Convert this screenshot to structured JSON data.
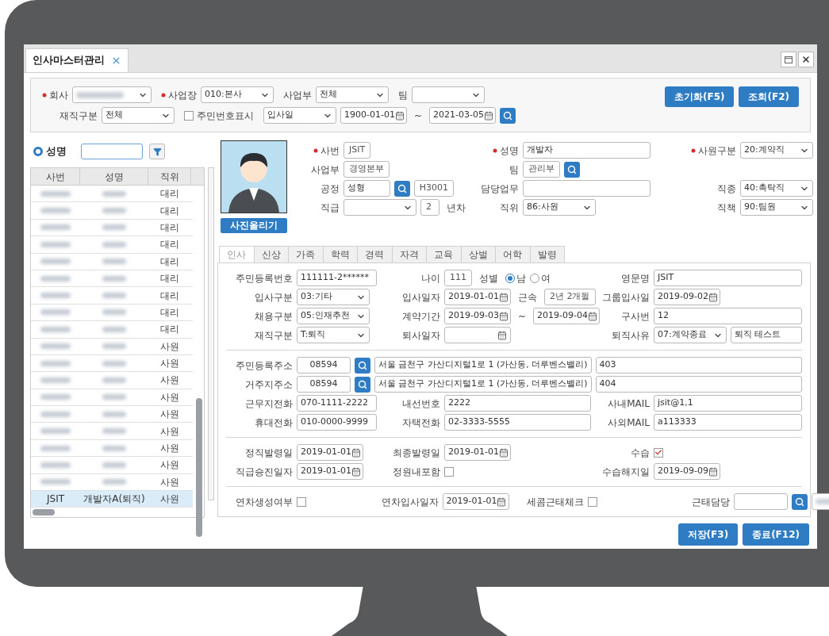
{
  "window": {
    "tab": "인사마스터관리"
  },
  "filter": {
    "rows": [
      [
        {
          "label": "회사",
          "required": true,
          "controls": [
            {
              "kind": "masked-select"
            }
          ]
        },
        {
          "label": "사업장",
          "required": true,
          "controls": [
            {
              "kind": "select",
              "value": "010:본사"
            }
          ]
        },
        {
          "label": "사업부",
          "required": false,
          "controls": [
            {
              "kind": "select",
              "value": "전체"
            }
          ]
        },
        {
          "label": "팀",
          "required": false,
          "controls": [
            {
              "kind": "select"
            }
          ]
        }
      ],
      [
        {
          "label": "재직구분",
          "required": false,
          "controls": [
            {
              "kind": "select",
              "value": "전체"
            }
          ]
        },
        {
          "controls": [
            {
              "kind": "check",
              "checked": false,
              "label": "주민번호표시"
            }
          ]
        },
        {
          "controls": [
            {
              "kind": "select",
              "value": "입사일"
            },
            {
              "kind": "date",
              "value": "1900-01-01"
            },
            {
              "kind": "text",
              "value": "~"
            },
            {
              "kind": "date",
              "value": "2021-03-05"
            },
            {
              "kind": "search"
            }
          ]
        }
      ]
    ],
    "buttons": [
      "초기화(F5)",
      "조회(F2)"
    ]
  },
  "list": {
    "radio": {
      "label": "성명",
      "selected": true
    },
    "columns": [
      "사번",
      "성명",
      "직위"
    ],
    "rows": [
      {
        "position": "대리",
        "selected": false
      },
      {
        "position": "대리",
        "selected": false
      },
      {
        "position": "대리",
        "selected": false
      },
      {
        "position": "대리",
        "selected": false
      },
      {
        "position": "대리",
        "selected": false
      },
      {
        "position": "대리",
        "selected": false
      },
      {
        "position": "대리",
        "selected": false
      },
      {
        "position": "대리",
        "selected": false
      },
      {
        "position": "대리",
        "selected": false
      },
      {
        "position": "사원",
        "selected": false
      },
      {
        "position": "사원",
        "selected": false
      },
      {
        "position": "사원",
        "selected": false
      },
      {
        "position": "사원",
        "selected": false
      },
      {
        "position": "사원",
        "selected": false
      },
      {
        "position": "사원",
        "selected": false
      },
      {
        "position": "사원",
        "selected": false
      },
      {
        "position": "사원",
        "selected": false
      },
      {
        "position": "사원",
        "selected": false
      },
      {
        "number": "JSIT",
        "name": "개발자A(퇴직)",
        "position": "사원",
        "selected": true
      }
    ]
  },
  "photo_button": "사진올리기",
  "header": {
    "rows": [
      [
        {
          "label": "사번",
          "required": true,
          "controls": [
            {
              "kind": "readonly",
              "value": "JSIT"
            }
          ]
        },
        {
          "label": "성명",
          "required": true,
          "controls": [
            {
              "kind": "input",
              "value": "개발자"
            }
          ]
        },
        {
          "label": "사원구분",
          "required": true,
          "controls": [
            {
              "kind": "select",
              "value": "20:계약직"
            }
          ]
        }
      ],
      [
        {
          "label": "사업부",
          "required": false,
          "controls": [
            {
              "kind": "readonly",
              "value": "경영본부"
            }
          ]
        },
        {
          "label": "팀",
          "required": false,
          "controls": [
            {
              "kind": "readonly",
              "value": "관리부"
            },
            {
              "kind": "search"
            }
          ]
        }
      ],
      [
        {
          "label": "공정",
          "required": false,
          "controls": [
            {
              "kind": "input",
              "value": "성형"
            },
            {
              "kind": "search"
            },
            {
              "kind": "readonly",
              "value": "H3001"
            }
          ]
        },
        {
          "label": "담당업무",
          "required": false,
          "controls": [
            {
              "kind": "input"
            }
          ]
        },
        {
          "label": "직종",
          "required": false,
          "controls": [
            {
              "kind": "select",
              "value": "40:촉탁직"
            }
          ]
        }
      ],
      [
        {
          "label": "직급",
          "required": false,
          "controls": [
            {
              "kind": "select"
            },
            {
              "kind": "readonly",
              "value": "2"
            },
            {
              "kind": "text",
              "value": "년차"
            }
          ]
        },
        {
          "label": "직위",
          "required": false,
          "controls": [
            {
              "kind": "select",
              "value": "86:사원"
            }
          ]
        },
        {
          "label": "직책",
          "required": false,
          "controls": [
            {
              "kind": "select",
              "value": "90:팀원"
            }
          ]
        }
      ]
    ]
  },
  "tabs": [
    {
      "label": "인사",
      "selected": true
    },
    {
      "label": "신상",
      "selected": false
    },
    {
      "label": "가족",
      "selected": false
    },
    {
      "label": "학력",
      "selected": false
    },
    {
      "label": "경력",
      "selected": false
    },
    {
      "label": "자격",
      "selected": false
    },
    {
      "label": "교육",
      "selected": false
    },
    {
      "label": "상벌",
      "selected": false
    },
    {
      "label": "어학",
      "selected": false
    },
    {
      "label": "발령",
      "selected": false
    }
  ],
  "sections": [
    {
      "rows": [
        [
          {
            "label": "주민등록번호",
            "controls": [
              {
                "kind": "input",
                "value": "111111-2******"
              }
            ]
          },
          {
            "label": "나이",
            "controls": [
              {
                "kind": "readonly",
                "value": "111"
              },
              {
                "kind": "text",
                "value": "성별"
              },
              {
                "kind": "radio",
                "label": "남",
                "selected": true
              },
              {
                "kind": "radio",
                "label": "여",
                "selected": false
              }
            ]
          },
          {
            "label": "영문명",
            "controls": [
              {
                "kind": "input",
                "value": "JSIT"
              }
            ]
          }
        ],
        [
          {
            "label": "입사구분",
            "controls": [
              {
                "kind": "select",
                "value": "03:기타"
              }
            ]
          },
          {
            "label": "입사일자",
            "controls": [
              {
                "kind": "date",
                "value": "2019-01-01"
              },
              {
                "kind": "text",
                "value": "근속"
              },
              {
                "kind": "readonly",
                "value": "2년 2개월"
              }
            ]
          },
          {
            "label": "그룹입사일",
            "controls": [
              {
                "kind": "date",
                "value": "2019-09-02"
              }
            ]
          }
        ],
        [
          {
            "label": "채용구분",
            "controls": [
              {
                "kind": "select",
                "value": "05:인재추천"
              }
            ]
          },
          {
            "label": "계약기간",
            "controls": [
              {
                "kind": "date",
                "value": "2019-09-03"
              },
              {
                "kind": "text",
                "value": "~"
              },
              {
                "kind": "date",
                "value": "2019-09-04"
              }
            ]
          },
          {
            "label": "구사번",
            "controls": [
              {
                "kind": "input",
                "value": "12"
              }
            ]
          }
        ],
        [
          {
            "label": "재직구분",
            "controls": [
              {
                "kind": "select",
                "value": "T:퇴직"
              }
            ]
          },
          {
            "label": "퇴사일자",
            "controls": [
              {
                "kind": "date"
              }
            ]
          },
          {
            "label": "퇴직사유",
            "controls": [
              {
                "kind": "select",
                "value": "07:계약종료"
              },
              {
                "kind": "input",
                "value": "퇴직 테스트"
              }
            ]
          }
        ]
      ]
    },
    {
      "rows": [
        [
          {
            "label": "주민등록주소",
            "controls": [
              {
                "kind": "code",
                "value": "08594"
              },
              {
                "kind": "search"
              },
              {
                "kind": "input",
                "value": "서울 금천구 가산디지털1로 1 (가산동, 더루벤스밸리)"
              },
              {
                "kind": "input",
                "value": "403"
              }
            ]
          }
        ],
        [
          {
            "label": "거주지주소",
            "controls": [
              {
                "kind": "code",
                "value": "08594"
              },
              {
                "kind": "search"
              },
              {
                "kind": "input",
                "value": "서울 금천구 가산디지털1로 1 (가산동, 더루벤스밸리)"
              },
              {
                "kind": "input",
                "value": "404"
              }
            ]
          }
        ],
        [
          {
            "label": "근무지전화",
            "controls": [
              {
                "kind": "input",
                "value": "070-1111-2222"
              }
            ]
          },
          {
            "label": "내선번호",
            "controls": [
              {
                "kind": "input",
                "value": "2222"
              }
            ]
          },
          {
            "label": "사내MAIL",
            "controls": [
              {
                "kind": "input",
                "value": "jsit@1,1"
              }
            ]
          }
        ],
        [
          {
            "label": "휴대전화",
            "controls": [
              {
                "kind": "input",
                "value": "010-0000-9999"
              }
            ]
          },
          {
            "label": "자택전화",
            "controls": [
              {
                "kind": "input",
                "value": "02-3333-5555"
              }
            ]
          },
          {
            "label": "사외MAIL",
            "controls": [
              {
                "kind": "input",
                "value": "a113333"
              }
            ]
          }
        ]
      ]
    },
    {
      "rows": [
        [
          {
            "label": "정직발령일",
            "controls": [
              {
                "kind": "date",
                "value": "2019-01-01"
              }
            ]
          },
          {
            "label": "최종발령일",
            "controls": [
              {
                "kind": "date",
                "value": "2019-01-01"
              }
            ]
          },
          {
            "label": "수습",
            "controls": [
              {
                "kind": "check",
                "checked": true
              }
            ]
          }
        ],
        [
          {
            "label": "직급승진일자",
            "controls": [
              {
                "kind": "date",
                "value": "2019-01-01"
              }
            ]
          },
          {
            "label": "정원내포함",
            "controls": [
              {
                "kind": "check",
                "checked": false
              }
            ]
          },
          {
            "label": "수습해지일",
            "controls": [
              {
                "kind": "date",
                "value": "2019-09-09"
              }
            ]
          }
        ]
      ]
    },
    {
      "rows": [
        [
          {
            "label": "연차생성여부",
            "controls": [
              {
                "kind": "check",
                "checked": false
              }
            ]
          },
          {
            "label": "연차입사일자",
            "controls": [
              {
                "kind": "date",
                "value": "2019-01-01"
              }
            ]
          },
          {
            "label": "세콤근태체크",
            "controls": [
              {
                "kind": "check",
                "checked": false
              }
            ]
          },
          {
            "label": "근태담당",
            "controls": [
              {
                "kind": "code"
              },
              {
                "kind": "search"
              },
              {
                "kind": "masked-input"
              }
            ]
          }
        ]
      ]
    }
  ],
  "footer_buttons": [
    "저장(F3)",
    "종료(F12)"
  ]
}
